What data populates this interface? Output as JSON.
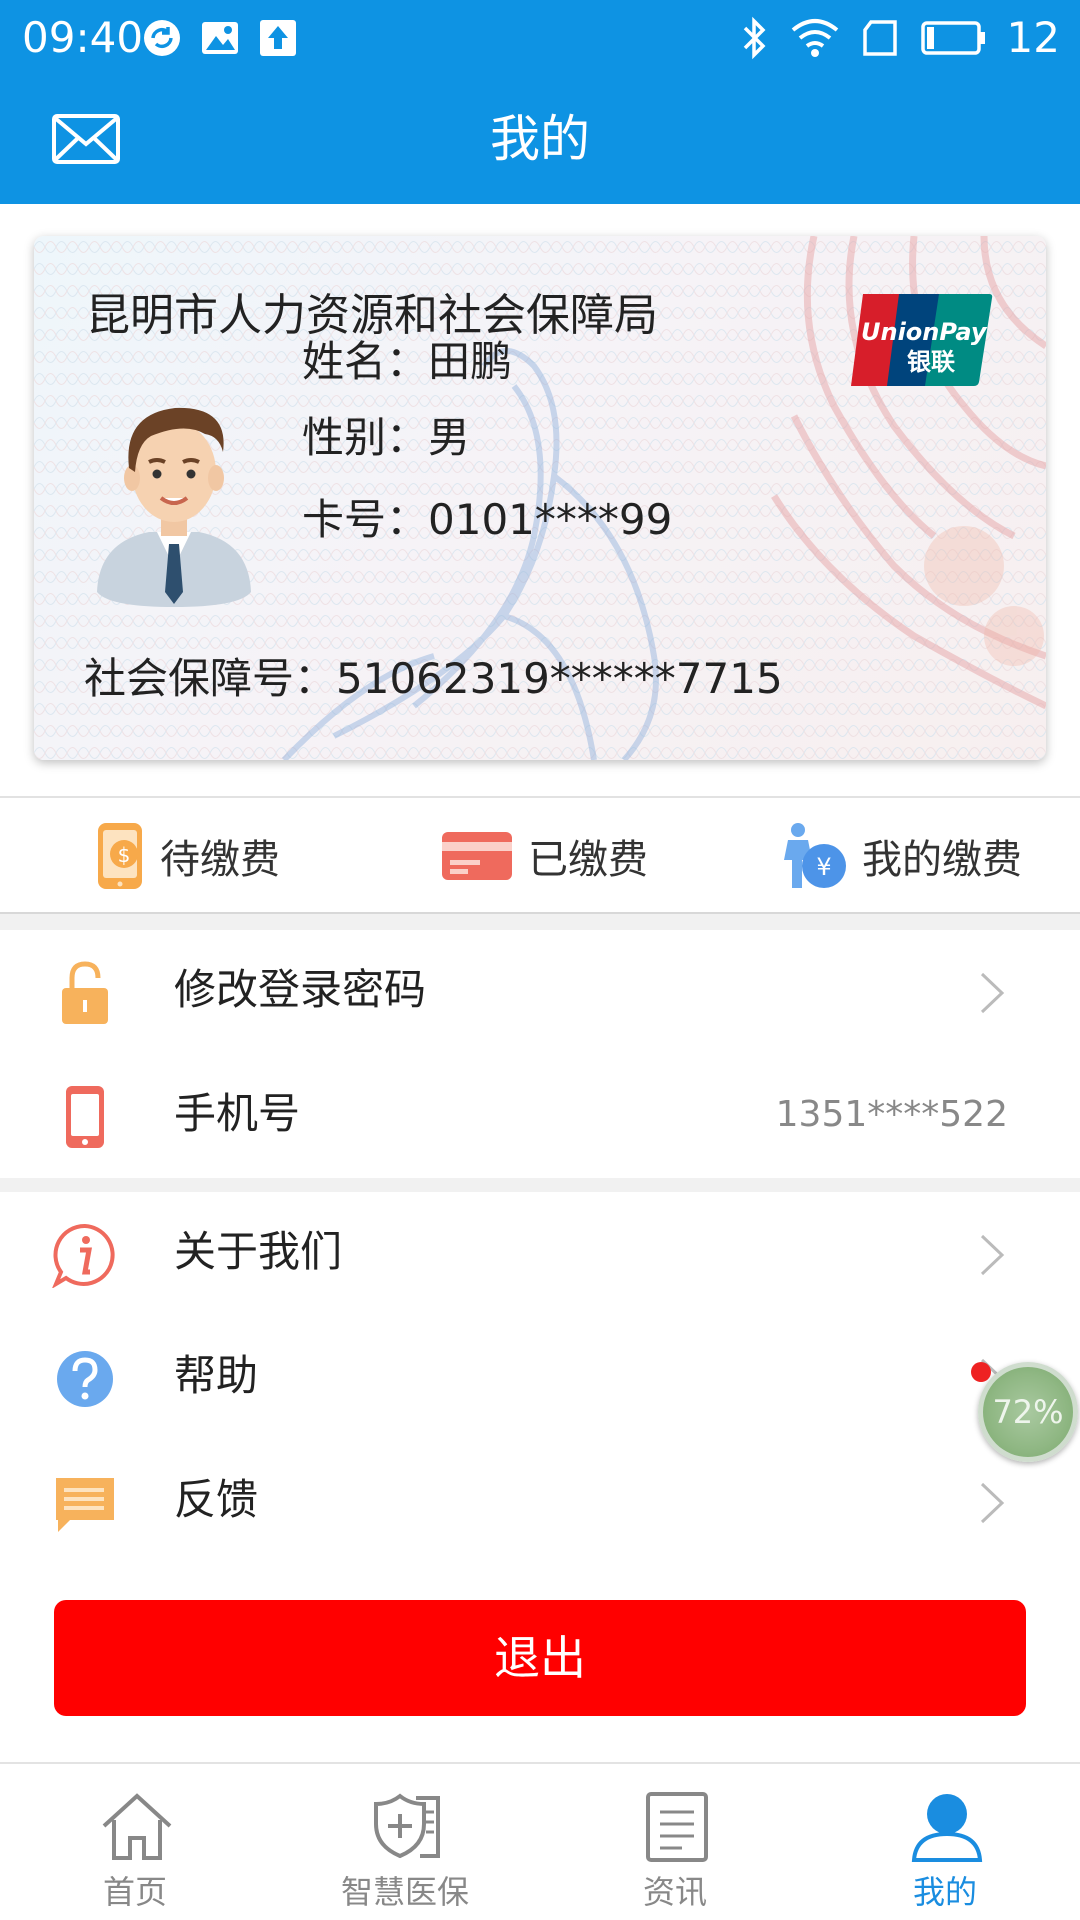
{
  "status_bar": {
    "time": "09:40",
    "battery": "12",
    "icons": [
      "sync-icon",
      "image-icon",
      "upload-icon",
      "bluetooth-icon",
      "wifi-icon",
      "sim-icon",
      "battery-icon"
    ]
  },
  "header": {
    "title": "我的",
    "left_icon": "mail-icon"
  },
  "card": {
    "org": "昆明市人力资源和社会保障局",
    "name_label": "姓名：",
    "name": "田鹏",
    "gender_label": "性别：",
    "gender": "男",
    "card_label": "卡号：",
    "card_no": "0101****99",
    "ssn_label": "社会保障号：",
    "ssn": "51062319******7715",
    "logo_text_1": "UnionPay",
    "logo_text_2": "银联"
  },
  "fees": [
    {
      "label": "待缴费",
      "icon": "phone-coin-icon"
    },
    {
      "label": "已缴费",
      "icon": "credit-card-icon"
    },
    {
      "label": "我的缴费",
      "icon": "yen-person-icon"
    }
  ],
  "menu_group_1": [
    {
      "label": "修改登录密码",
      "icon": "lock-icon",
      "value": ""
    },
    {
      "label": "手机号",
      "icon": "mobile-icon",
      "value": "1351****522"
    }
  ],
  "menu_group_2": [
    {
      "label": "关于我们",
      "icon": "info-icon"
    },
    {
      "label": "帮助",
      "icon": "help-icon"
    },
    {
      "label": "反馈",
      "icon": "feedback-icon"
    }
  ],
  "floating_badge": "72%",
  "logout_label": "退出",
  "bottom_nav": [
    {
      "label": "首页",
      "icon": "home-icon",
      "active": false
    },
    {
      "label": "智慧医保",
      "icon": "medical-shield-icon",
      "active": false
    },
    {
      "label": "资讯",
      "icon": "news-icon",
      "active": false
    },
    {
      "label": "我的",
      "icon": "user-icon",
      "active": true
    }
  ],
  "colors": {
    "primary": "#0e93e3",
    "logout": "#ff0000",
    "nav_active": "#1a8de0"
  }
}
